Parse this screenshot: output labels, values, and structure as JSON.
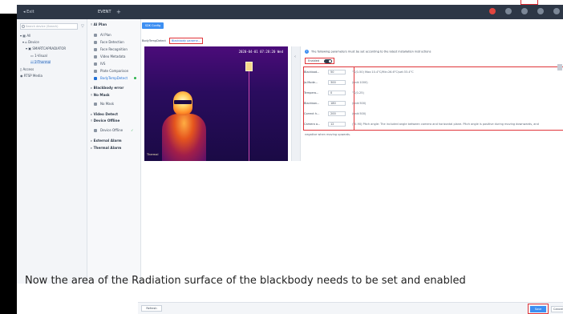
{
  "titlebar": {
    "back_label": "Exit",
    "tab_label": "EVENT",
    "add_tab": "+"
  },
  "tree": {
    "search_placeholder": "Search device (Search)",
    "nodes": [
      "All",
      "Device",
      "SMARTCAPRADIATOR",
      "1-Visual",
      "2-Thermal",
      "Access",
      "RTSP Media"
    ]
  },
  "menu": {
    "groups": {
      "ai_plan": "AI Plan",
      "blackbody_error": "Blackbody error",
      "no_mask": "No Mask",
      "video_detect": "Video Detect",
      "device_offline": "Device Offline",
      "external_alarm": "External Alarm",
      "thermal_alarm": "Thermal Alarm"
    },
    "items": {
      "ai_plan": "AI Plan",
      "face_detection": "Face Detection",
      "face_recognition": "Face Recognition",
      "video_metadata": "Video Metadata",
      "ivs": "IVS",
      "plate_comparison": "Plate Comparison",
      "body_temp_detect": "BodyTempDetect",
      "no_mask": "No Mask",
      "device_offline": "Device Offline"
    }
  },
  "main": {
    "top_button": "SDK Config",
    "tabs": {
      "body_temp": "BodyTempDetect",
      "blackbody": "Blackbody parame..."
    },
    "video": {
      "timestamp": "2020-04-01 07:28:20 Wed",
      "camera_label": "Thermal"
    },
    "params": {
      "notice": "The following parameters must be set according to the latest installation instructions",
      "enable_label": "Enabled",
      "rows": [
        {
          "label": "Blackbod...",
          "value": "50",
          "hint": "°C(0-50) Max:10.4°C/Min:26.6°C/set:33.4°C"
        },
        {
          "label": "Ja.Mode...",
          "value": "300",
          "hint": "(unit:1000)"
        },
        {
          "label": "Tempera...",
          "value": "0",
          "hint": "°C(0-25)"
        },
        {
          "label": "Blackbon...",
          "value": "180",
          "hint": "(unit:500)"
        },
        {
          "label": "Correct h...",
          "value": "200",
          "hint": "(unit:500)"
        },
        {
          "label": "Camera a...",
          "value": "12",
          "hint": "(°0-90) Pitch angle: The included angle between camera and horizontal plane. Pitch angle is positive during moving downwards, and"
        }
      ],
      "footnote": "negative when moving upwards."
    }
  },
  "caption": "Now the area of the Radiation surface of the blackbody needs to be set and enabled",
  "bottom": {
    "refresh": "Refresh",
    "save": "Save",
    "cancel": "Cancel"
  },
  "colors": {
    "titlebar": "#2d3746",
    "accent": "#3d8ff2",
    "highlight": "#e0353a"
  }
}
